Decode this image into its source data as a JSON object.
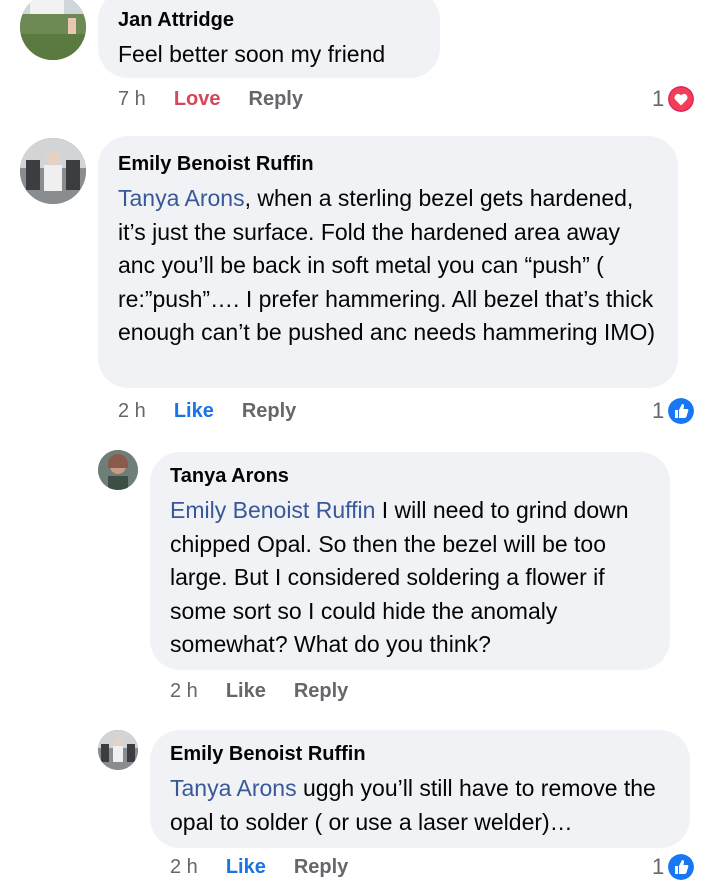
{
  "comments": [
    {
      "author": "Jan Attridge",
      "text": "Feel better soon my friend",
      "time": "7 h",
      "action1": "Love",
      "action2": "Reply",
      "reaction_count": "1",
      "reaction_icon": "heart-icon",
      "reaction_color": "#e0245e"
    },
    {
      "author": "Emily Benoist Ruffin",
      "mention": "Tanya Arons",
      "text": ", when a sterling bezel gets hardened, it’s just the surface. Fold the hardened area away anc you’ll be back in soft metal you can “push” ( re:”push”…. I prefer hammering. All  bezel that’s thick enough can’t be pushed anc needs hammering IMO)",
      "time": "2 h",
      "action1": "Like",
      "action2": "Reply",
      "reaction_count": "1",
      "reaction_icon": "thumbs-up-icon",
      "reaction_color": "#1877f2"
    },
    {
      "author": "Tanya Arons",
      "mention": "Emily Benoist Ruffin",
      "text": " I will need to grind down chipped Opal. So then the bezel will be too large.  But I considered soldering a flower if some sort so I could hide the anomaly somewhat? What do you think?",
      "time": "2 h",
      "action1": "Like",
      "action2": "Reply"
    },
    {
      "author": "Emily Benoist Ruffin",
      "mention": "Tanya Arons",
      "text": " uggh you’ll still have to remove the opal to solder ( or use a laser welder)…",
      "time": "2 h",
      "action1": "Like",
      "action2": "Reply",
      "reaction_count": "1",
      "reaction_icon": "thumbs-up-icon",
      "reaction_color": "#1877f2"
    }
  ]
}
